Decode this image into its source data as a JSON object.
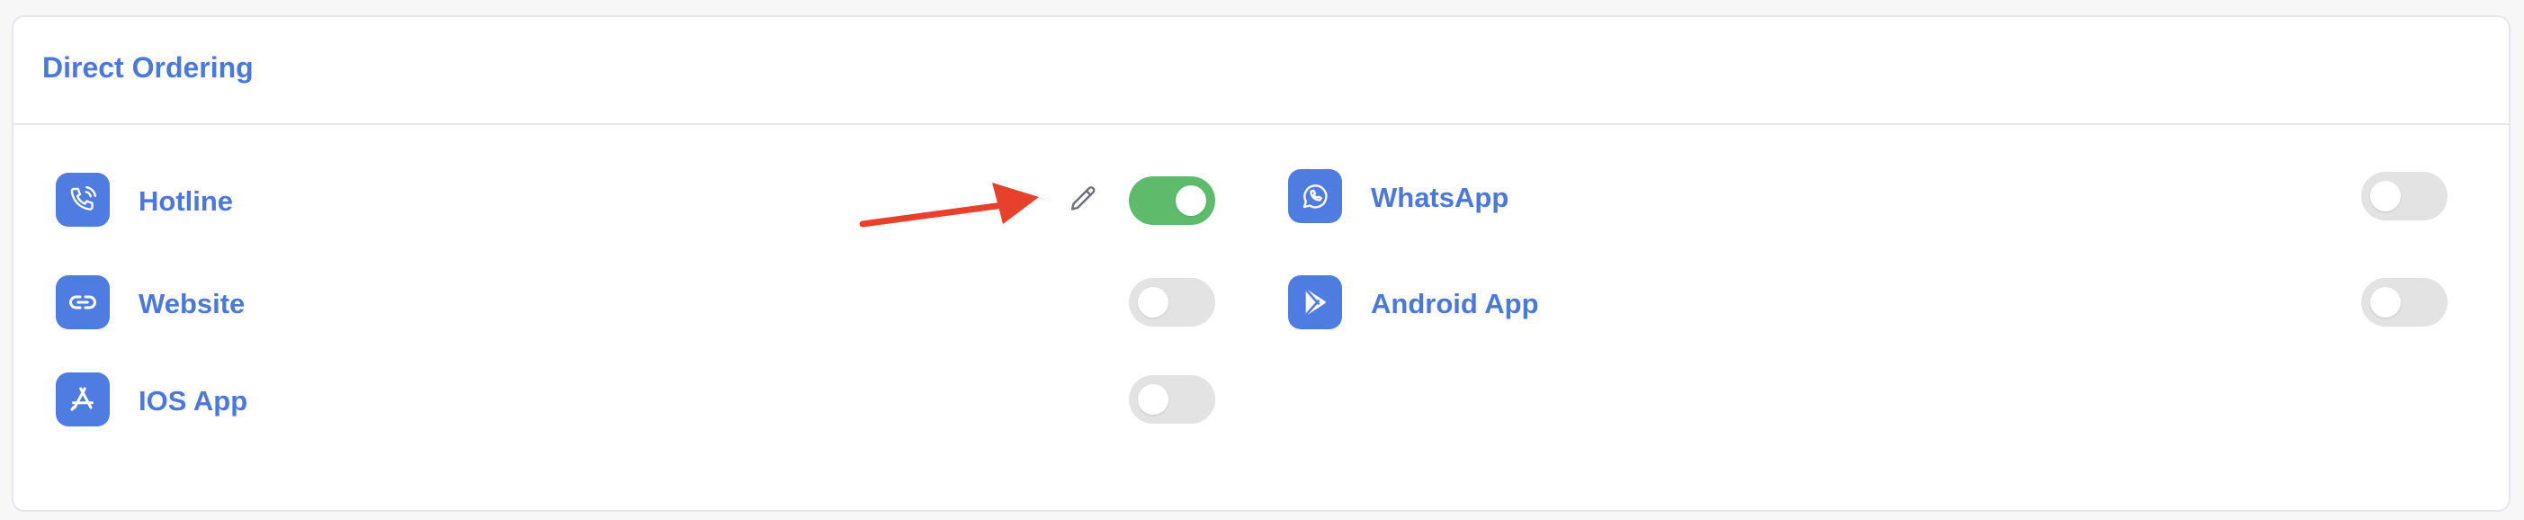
{
  "card": {
    "title": "Direct Ordering"
  },
  "channels": [
    {
      "label": "Hotline",
      "icon": "phone-icon",
      "enabled": true,
      "editable": true
    },
    {
      "label": "Website",
      "icon": "link-icon",
      "enabled": false
    },
    {
      "label": "IOS App",
      "icon": "app-store-icon",
      "enabled": false
    },
    {
      "label": "WhatsApp",
      "icon": "whatsapp-icon",
      "enabled": true
    },
    {
      "label": "Android App",
      "icon": "play-store-icon",
      "enabled": false
    }
  ],
  "colors": {
    "accent": "#4a78dd",
    "icon_bg": "#4f7ce1",
    "toggle_on": "#5ebb6c",
    "toggle_off": "#e3e3e4",
    "annotation_arrow": "#e8412b"
  }
}
